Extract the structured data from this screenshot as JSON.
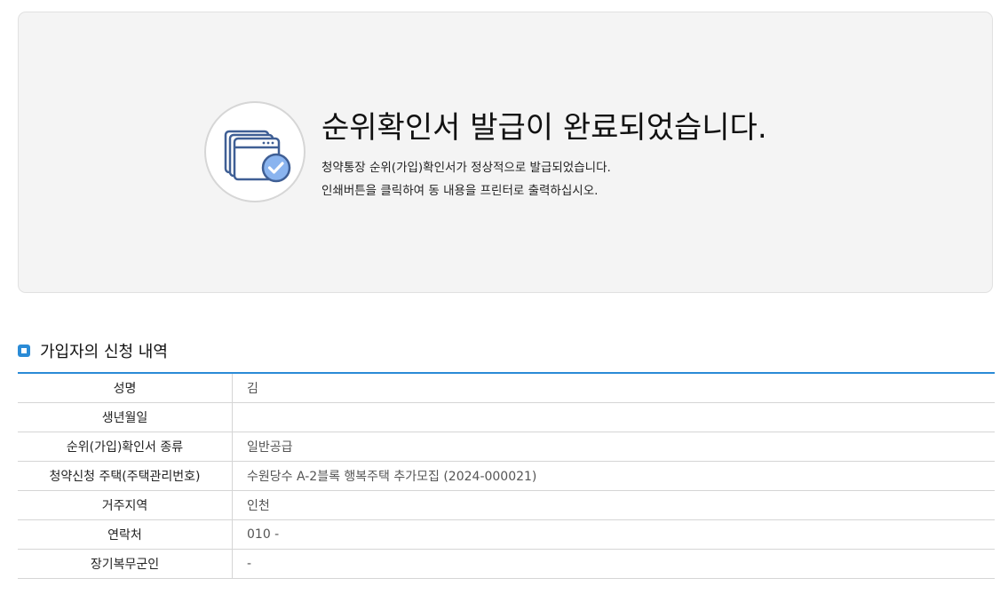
{
  "result": {
    "icon": "certificate-check-icon",
    "title": "순위확인서 발급이 완료되었습니다.",
    "desc_line1": "청약통장 순위(가입)확인서가 정상적으로 발급되었습니다.",
    "desc_line2": "인쇄버튼을 클릭하여 동 내용을 프린터로 출력하십시오."
  },
  "section": {
    "title": "가입자의 신청 내역"
  },
  "details": [
    {
      "label": "성명",
      "value": "김"
    },
    {
      "label": "생년월일",
      "value": ""
    },
    {
      "label": "순위(가입)확인서 종류",
      "value": "일반공급"
    },
    {
      "label": "청약신청 주택(주택관리번호)",
      "value": "수원당수 A-2블록 행복주택 추가모집 (2024-000021)"
    },
    {
      "label": "거주지역",
      "value": "인천"
    },
    {
      "label": "연락처",
      "value": "010 -"
    },
    {
      "label": "장기복무군인",
      "value": "-"
    }
  ],
  "colors": {
    "accent": "#2a8bd6",
    "panel_bg": "#f4f4f4",
    "icon_blue": "#3f5f95",
    "icon_badge": "#8ab4ef"
  }
}
